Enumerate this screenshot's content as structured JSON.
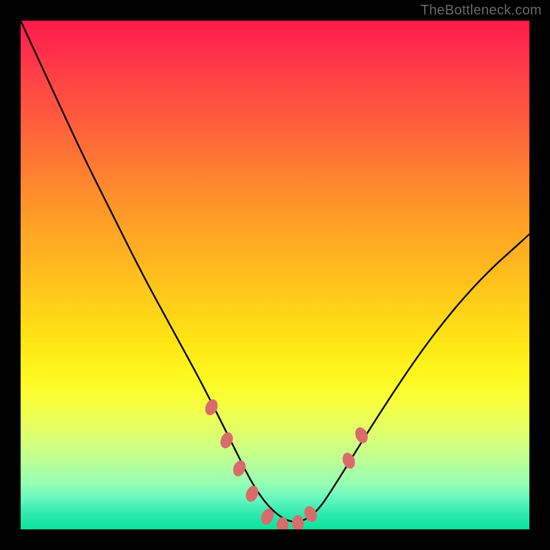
{
  "watermark": "TheBottleneck.com",
  "chart_data": {
    "type": "line",
    "title": "",
    "xlabel": "",
    "ylabel": "",
    "xlim": [
      0,
      100
    ],
    "ylim": [
      0,
      100
    ],
    "grid": false,
    "legend": false,
    "series": [
      {
        "name": "curve",
        "x": [
          0,
          6,
          12,
          18,
          24,
          30,
          36,
          42,
          46,
          50,
          54,
          58,
          62,
          70,
          80,
          90,
          100
        ],
        "y": [
          100,
          87,
          74,
          62,
          50,
          39,
          28,
          16,
          8,
          3,
          1,
          3,
          9,
          22,
          37,
          49,
          58
        ]
      }
    ],
    "markers": [
      {
        "x": 37.5,
        "y": 24
      },
      {
        "x": 40.5,
        "y": 17.5
      },
      {
        "x": 43.0,
        "y": 12
      },
      {
        "x": 45.5,
        "y": 7
      },
      {
        "x": 48.5,
        "y": 2.5
      },
      {
        "x": 51.5,
        "y": 0.8
      },
      {
        "x": 54.5,
        "y": 1.2
      },
      {
        "x": 57.0,
        "y": 3.0
      },
      {
        "x": 64.5,
        "y": 13.5
      },
      {
        "x": 67.0,
        "y": 18.5
      }
    ],
    "marker_color": "#d96b6b",
    "curve_color": "#000000",
    "background": "rainbow-gradient"
  }
}
